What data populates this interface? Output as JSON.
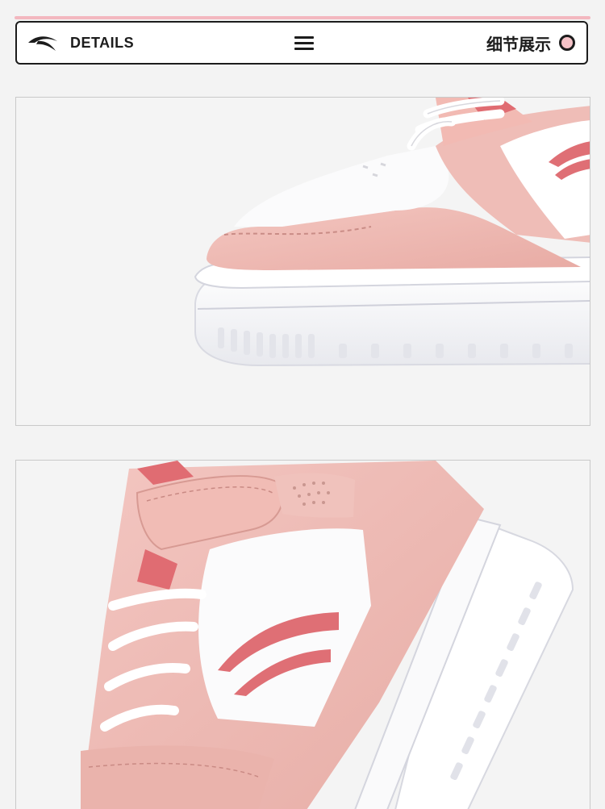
{
  "header": {
    "brand_icon": "anta-logo-icon",
    "title": "DETAILS",
    "menu_icon": "hamburger-menu-icon",
    "section_label": "细节展示",
    "indicator_icon": "pink-dot-icon"
  },
  "colors": {
    "accent_pink": "#f3b7bf",
    "leather_pink": "#eeb9b3",
    "logo_pink": "#df6f75",
    "ink": "#1c1c1c"
  },
  "gallery": {
    "panels": [
      {
        "image": "shoe-toe-detail-image"
      },
      {
        "image": "shoe-side-velcro-detail-image"
      }
    ]
  }
}
